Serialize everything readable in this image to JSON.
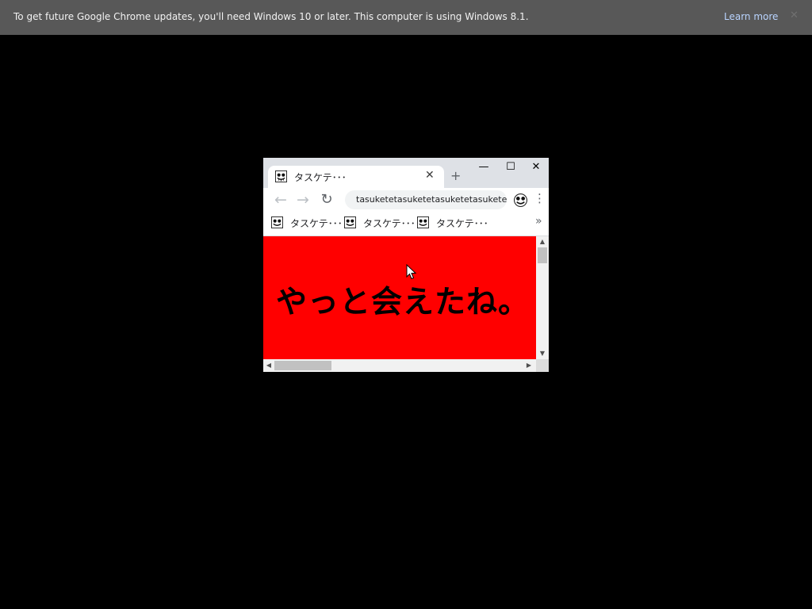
{
  "notification": {
    "message": "To get future Google Chrome updates, you'll need Windows 10 or later. This computer is using Windows 8.1.",
    "learn_more": "Learn more",
    "close_glyph": "✕"
  },
  "window": {
    "controls": {
      "minimize": "—",
      "maximize": "☐",
      "close": "✕"
    },
    "tab": {
      "title": "タスケテ･･･",
      "close_glyph": "✕",
      "favicon": "skull-face-icon"
    },
    "new_tab_glyph": "+",
    "toolbar": {
      "back_glyph": "←",
      "forward_glyph": "→",
      "reload_glyph": "↻",
      "url": "tasuketetasuketetasuketetasukete",
      "menu_glyph": "⋮"
    },
    "bookmarks": [
      {
        "label": "タスケテ･･･",
        "icon": "skull-face-icon"
      },
      {
        "label": "タスケテ･･･",
        "icon": "skull-face-icon"
      },
      {
        "label": "タスケテ･･･",
        "icon": "skull-face-icon"
      }
    ],
    "bookmarks_more_glyph": "»",
    "page": {
      "message": "やっと会えたね。",
      "background": "#ff0000"
    },
    "scrollbars": {
      "up": "▲",
      "down": "▼",
      "left": "◀",
      "right": "▶"
    }
  },
  "colors": {
    "desktop": "#000000",
    "notification_bar": "#585858",
    "link": "#b9d4ff"
  }
}
